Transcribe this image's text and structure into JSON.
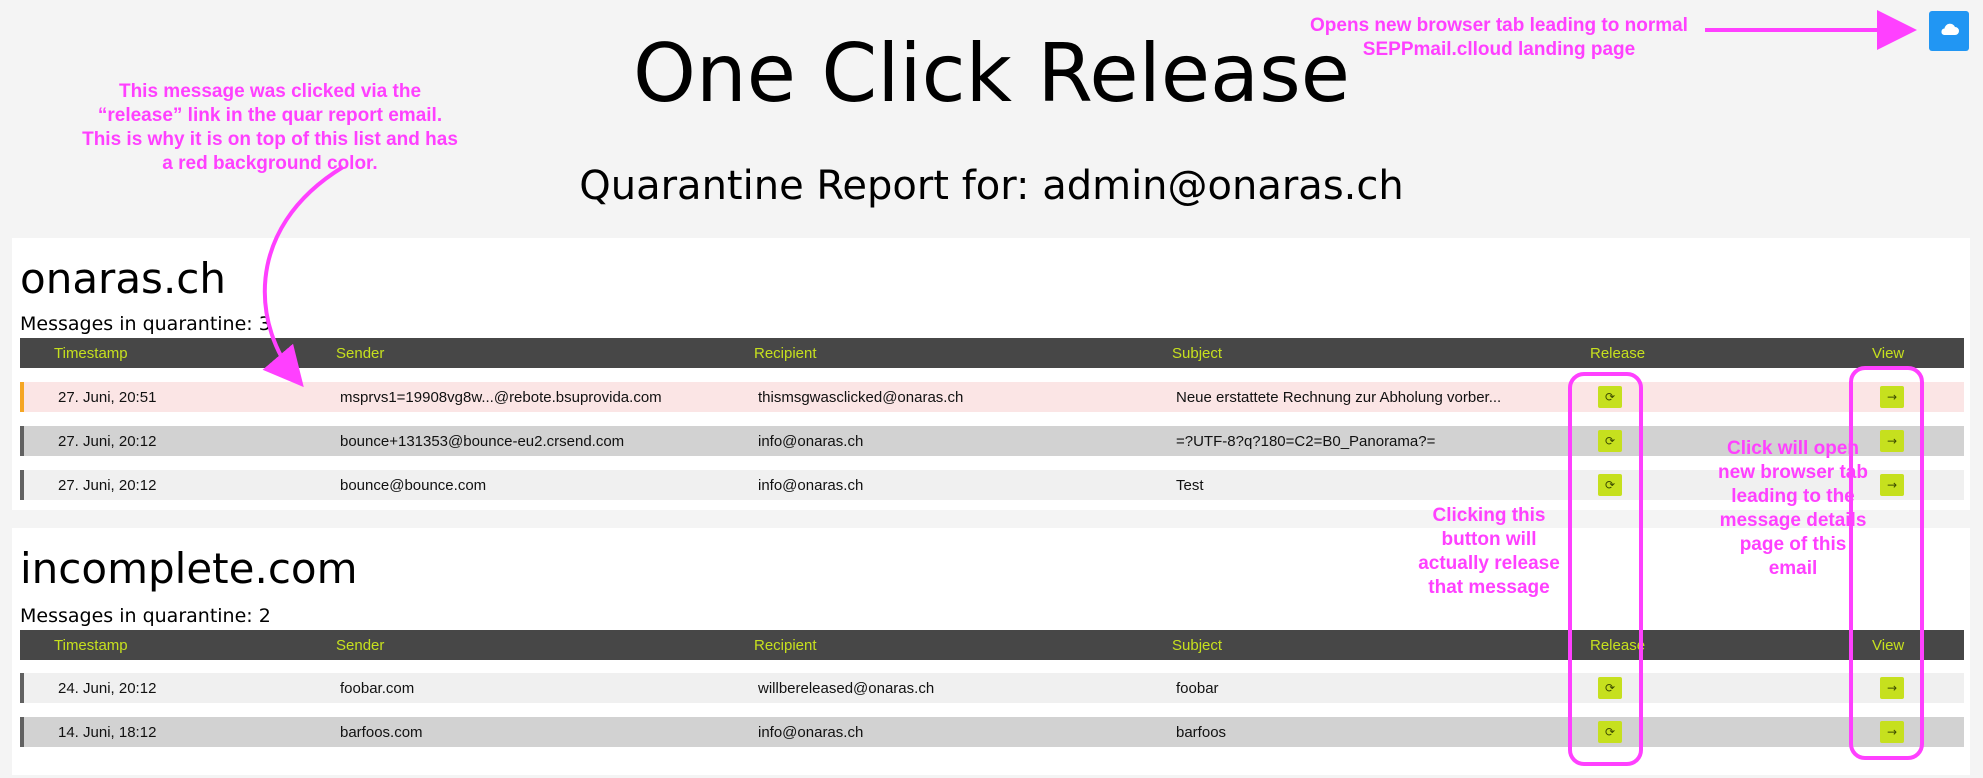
{
  "page": {
    "title": "One Click Release",
    "report_title": "Quarantine Report for: admin@onaras.ch"
  },
  "cloud_button": {
    "icon": "cloud-icon"
  },
  "table_headers": {
    "timestamp": "Timestamp",
    "sender": "Sender",
    "recipient": "Recipient",
    "subject": "Subject",
    "release": "Release",
    "view": "View"
  },
  "sections": [
    {
      "domain": "onaras.ch",
      "count_text": "Messages in quarantine: 3",
      "rows": [
        {
          "timestamp": "27. Juni, 20:51",
          "sender": "msprvs1=19908vg8w...@rebote.bsuprovida.com",
          "recipient": "thismsgwasclicked@onaras.ch",
          "subject": "Neue erstattete Rechnung zur Abholung vorber...",
          "highlighted": true
        },
        {
          "timestamp": "27. Juni, 20:12",
          "sender": "bounce+131353@bounce-eu2.crsend.com",
          "recipient": "info@onaras.ch",
          "subject": "=?UTF-8?q?180=C2=B0_Panorama?="
        },
        {
          "timestamp": "27. Juni, 20:12",
          "sender": "bounce@bounce.com",
          "recipient": "info@onaras.ch",
          "subject": "Test"
        }
      ]
    },
    {
      "domain": "incomplete.com",
      "count_text": "Messages in quarantine: 2",
      "rows": [
        {
          "timestamp": "24. Juni, 20:12",
          "sender": "foobar.com",
          "recipient": "willbereleased@onaras.ch",
          "subject": "foobar"
        },
        {
          "timestamp": "14. Juni, 18:12",
          "sender": "barfoos.com",
          "recipient": "info@onaras.ch",
          "subject": "barfoos"
        }
      ]
    }
  ],
  "icons": {
    "release": "refresh-icon",
    "view": "arrow-right-icon"
  },
  "annotations": {
    "highlight_note": "This message was clicked via the “release” link in the quar report email. This is why it is on top of this list and has a red background color.",
    "cloud_note": "Opens new browser tab leading to normal SEPPmail.clloud landing page",
    "release_note": "Clicking this button will actually release that message",
    "view_note": "Click will open new browser tab leading to the message details page of this email"
  },
  "colors": {
    "accent": "#c6e01e",
    "header_bg": "#474747",
    "highlight_bg": "#fbe5e5",
    "highlight_border": "#f5a623",
    "cloud_button": "#2196f3",
    "annotation": "#ff40ff"
  }
}
